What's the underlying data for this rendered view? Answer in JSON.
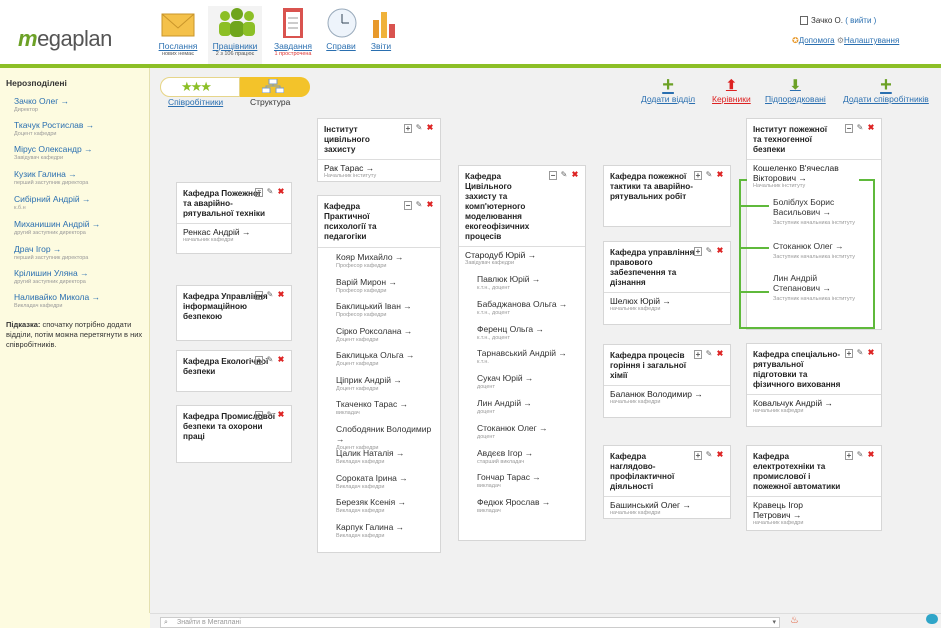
{
  "header": {
    "logo": "megaplan",
    "nav": [
      {
        "label": "Послання",
        "sub": "нових немає"
      },
      {
        "label": "Працівники",
        "sub": "2 з 106 працює"
      },
      {
        "label": "Завдання",
        "sub": "1 прострочена"
      },
      {
        "label": "Справи",
        "sub": ""
      },
      {
        "label": "Звіти",
        "sub": ""
      }
    ],
    "user": "Зачко О.",
    "logout": "( вийти )",
    "help": "Допомога",
    "settings": "Налаштування"
  },
  "sidebar": {
    "title": "Нерозподілені",
    "items": [
      {
        "name": "Зачко Олег →",
        "pos": "Директор"
      },
      {
        "name": "Ткачук Ростислав →",
        "pos": "Доцент кафедри"
      },
      {
        "name": "Мірус Олександр →",
        "pos": "Завідувач кафедри"
      },
      {
        "name": "Кузик Галина →",
        "pos": "перший заступник директора"
      },
      {
        "name": "Сибірний Андрій →",
        "pos": "к.б.н"
      },
      {
        "name": "Миханишин Андрій →",
        "pos": "другий заступник директора"
      },
      {
        "name": "Драч Ігор →",
        "pos": "перший заступник директора"
      },
      {
        "name": "Крілишин Уляна →",
        "pos": "другий заступник директора"
      },
      {
        "name": "Наливайко Микола →",
        "pos": "Викладач кафедри"
      }
    ],
    "hint_bold": "Підказка:",
    "hint": " спочатку потрібно додати відділи, потім можна перетягнути в них співробітників."
  },
  "tabs": {
    "employees": "Співробітники",
    "structure": "Структура"
  },
  "actions": {
    "add_dept": "Додати відділ",
    "managers": "Керівники",
    "subordinates": "Підпорядковані",
    "add_employees": "Додати співробітників"
  },
  "cards": {
    "pozh": {
      "title": "Кафедра Пожежної та аварійно-рятувальної техніки",
      "head": "Ренкас Андрій →",
      "headpos": "начальник кафедри"
    },
    "upr": {
      "title": "Кафедра Управління інформаційною безпекою"
    },
    "eco": {
      "title": "Кафедра Екологічної безпеки"
    },
    "prom": {
      "title": "Кафедра Промислової безпеки та охорони праці"
    },
    "izc": {
      "title": "Інститут цивільного захисту",
      "head": "Рак Тарас →",
      "headpos": "Начальник інституту"
    },
    "psy": {
      "title": "Кафедра Практичної психології та педагогіки",
      "employees": [
        {
          "name": "Кояр Михайло →",
          "pos": "Професор кафедри"
        },
        {
          "name": "Варій Мирон →",
          "pos": "Професор кафедри"
        },
        {
          "name": "Баклицький Іван →",
          "pos": "Професор кафедри"
        },
        {
          "name": "Сірко Роксолана →",
          "pos": "Доцент кафедри"
        },
        {
          "name": "Баклицька Ольга →",
          "pos": "Доцент кафедри"
        },
        {
          "name": "Ціприк Андрій →",
          "pos": "Доцент кафедри"
        },
        {
          "name": "Ткаченко Тарас →",
          "pos": "викладач"
        },
        {
          "name": "Слободяник Володимир →",
          "pos": "Доцент кафедри"
        },
        {
          "name": "Цалик Наталія →",
          "pos": "Викладач кафедри"
        },
        {
          "name": "Сороката Ірина →",
          "pos": "Викладач кафедри"
        },
        {
          "name": "Березяк Ксенія →",
          "pos": "Викладач кафедри"
        },
        {
          "name": "Карпук Галина →",
          "pos": "Викладач кафедри"
        }
      ]
    },
    "civ": {
      "title": "Кафедра Цивільного захисту та комп'ютерного моделювання екогеофізичних процесів",
      "head": "Стародуб Юрій →",
      "headpos": "Завідувач кафедри",
      "employees": [
        {
          "name": "Павлюк Юрій →",
          "pos": "к.т.н., доцент"
        },
        {
          "name": "Бабаджанова Ольга →",
          "pos": "к.т.н., доцент"
        },
        {
          "name": "Ференц Ольга →",
          "pos": "к.т.н., доцент"
        },
        {
          "name": "Тарнавський Андрій →",
          "pos": "к.т.н."
        },
        {
          "name": "Сукач Юрій →",
          "pos": "доцент"
        },
        {
          "name": "Лин Андрій →",
          "pos": "доцент"
        },
        {
          "name": "Стоканюк Олег →",
          "pos": "доцент"
        },
        {
          "name": "Авдєєв Ігор →",
          "pos": "старший викладач"
        },
        {
          "name": "Гончар Тарас →",
          "pos": "викладач"
        },
        {
          "name": "Федюк Ярослав →",
          "pos": "викладач"
        }
      ]
    },
    "takt": {
      "title": "Кафедра пожежної тактики та аварійно-рятувальних робіт"
    },
    "prav": {
      "title": "Кафедра управління правового забезпечення та дізнання",
      "head": "Шелюх Юрій →",
      "headpos": "начальник кафедри"
    },
    "proc": {
      "title": "Кафедра процесів горіння і загальної хімії",
      "head": "Баланюк Володимир →",
      "headpos": "начальник кафедри"
    },
    "nagl": {
      "title": "Кафедра наглядово-профілактичної діяльності",
      "head": "Башинський Олег →",
      "headpos": "начальник кафедри"
    },
    "inst2": {
      "title": "Інститут пожежної та техногенної безпеки",
      "head": "Кошеленко В'ячеслав Вікторович →",
      "headpos": "Начальник інституту",
      "deputies": [
        {
          "name": "Боліблух Борис Васильович →",
          "pos": "Заступник начальника інституту"
        },
        {
          "name": "Стоканюк Олег →",
          "pos": "Заступник начальника інституту"
        },
        {
          "name": "Лин Андрій Степанович →",
          "pos": "Заступник начальника інституту"
        }
      ]
    },
    "spec": {
      "title": "Кафедра спеціально-рятувальної підготовки та фізичного виховання",
      "head": "Ковальчук Андрій →",
      "headpos": "начальник кафедри"
    },
    "elec": {
      "title": "Кафедра електротехніки та промислової і пожежної автоматики",
      "head": "Кравець Ігор Петрович →",
      "headpos": "начальник кафедри"
    }
  },
  "footer": {
    "search_placeholder": "Знайти в Мегаплані"
  }
}
